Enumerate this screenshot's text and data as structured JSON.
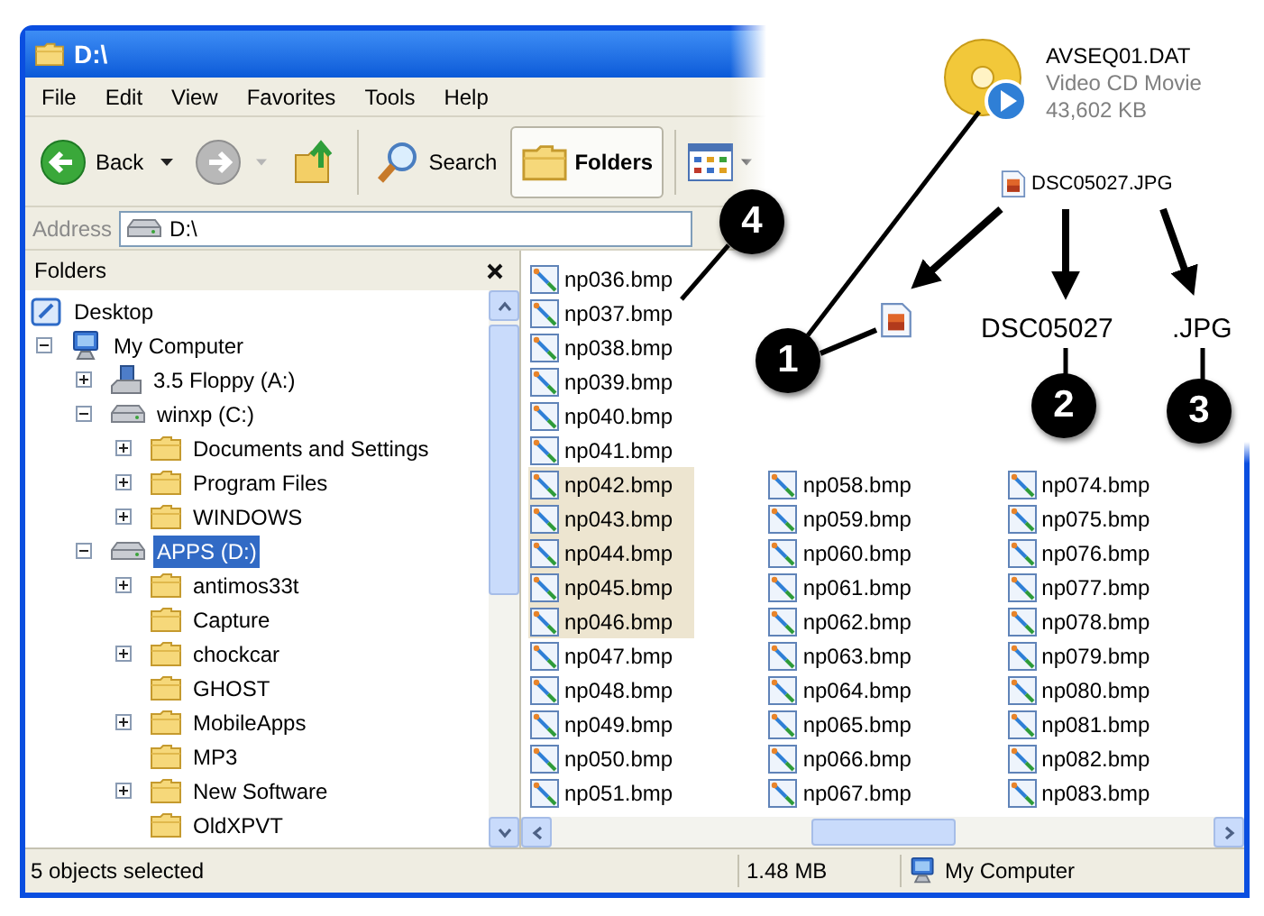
{
  "window": {
    "title": "D:\\"
  },
  "menu": [
    "File",
    "Edit",
    "View",
    "Favorites",
    "Tools",
    "Help"
  ],
  "toolbar": {
    "back": {
      "label": "Back"
    },
    "forward": {
      "disabled": true
    },
    "search": {
      "label": "Search"
    },
    "folders": {
      "label": "Folders",
      "selected": true
    }
  },
  "address": {
    "label": "Address",
    "value": "D:\\"
  },
  "folders_pane": {
    "title": "Folders",
    "tree": [
      {
        "label": "Desktop",
        "kind": "desktop",
        "expandable": false,
        "selected": false,
        "children": [
          {
            "label": "My Computer",
            "kind": "computer",
            "expandable": true,
            "expanded": true,
            "selected": false,
            "children": [
              {
                "label": "3.5 Floppy (A:)",
                "kind": "floppy",
                "expandable": true,
                "expanded": false,
                "selected": false
              },
              {
                "label": "winxp (C:)",
                "kind": "drive",
                "expandable": true,
                "expanded": true,
                "selected": false,
                "children": [
                  {
                    "label": "Documents and Settings",
                    "kind": "folder",
                    "expandable": true,
                    "expanded": false,
                    "selected": false
                  },
                  {
                    "label": "Program Files",
                    "kind": "folder",
                    "expandable": true,
                    "expanded": false,
                    "selected": false
                  },
                  {
                    "label": "WINDOWS",
                    "kind": "folder",
                    "expandable": true,
                    "expanded": false,
                    "selected": false
                  }
                ]
              },
              {
                "label": "APPS (D:)",
                "kind": "drive",
                "expandable": true,
                "expanded": true,
                "selected": true,
                "children": [
                  {
                    "label": "antimos33t",
                    "kind": "folder",
                    "expandable": true,
                    "expanded": false,
                    "selected": false
                  },
                  {
                    "label": "Capture",
                    "kind": "folder",
                    "expandable": false,
                    "selected": false
                  },
                  {
                    "label": "chockcar",
                    "kind": "folder",
                    "expandable": true,
                    "expanded": false,
                    "selected": false
                  },
                  {
                    "label": "GHOST",
                    "kind": "folder",
                    "expandable": false,
                    "selected": false
                  },
                  {
                    "label": "MobileApps",
                    "kind": "folder",
                    "expandable": true,
                    "expanded": false,
                    "selected": false
                  },
                  {
                    "label": "MP3",
                    "kind": "folder",
                    "expandable": false,
                    "selected": false
                  },
                  {
                    "label": "New Software",
                    "kind": "folder",
                    "expandable": true,
                    "expanded": false,
                    "selected": false
                  },
                  {
                    "label": "OldXPVT",
                    "kind": "folder",
                    "expandable": false,
                    "selected": false
                  }
                ]
              }
            ]
          }
        ]
      }
    ]
  },
  "file_list": {
    "columns": [
      {
        "items": [
          {
            "name": "np036.bmp",
            "selected": false
          },
          {
            "name": "np037.bmp",
            "selected": false
          },
          {
            "name": "np038.bmp",
            "selected": false
          },
          {
            "name": "np039.bmp",
            "selected": false
          },
          {
            "name": "np040.bmp",
            "selected": false
          },
          {
            "name": "np041.bmp",
            "selected": false
          },
          {
            "name": "np042.bmp",
            "selected": true
          },
          {
            "name": "np043.bmp",
            "selected": true
          },
          {
            "name": "np044.bmp",
            "selected": true
          },
          {
            "name": "np045.bmp",
            "selected": true
          },
          {
            "name": "np046.bmp",
            "selected": true
          },
          {
            "name": "np047.bmp",
            "selected": false
          },
          {
            "name": "np048.bmp",
            "selected": false
          },
          {
            "name": "np049.bmp",
            "selected": false
          },
          {
            "name": "np050.bmp",
            "selected": false
          },
          {
            "name": "np051.bmp",
            "selected": false
          }
        ]
      },
      {
        "items": [
          {
            "name": "np058.bmp",
            "selected": false
          },
          {
            "name": "np059.bmp",
            "selected": false
          },
          {
            "name": "np060.bmp",
            "selected": false
          },
          {
            "name": "np061.bmp",
            "selected": false
          },
          {
            "name": "np062.bmp",
            "selected": false
          },
          {
            "name": "np063.bmp",
            "selected": false
          },
          {
            "name": "np064.bmp",
            "selected": false
          },
          {
            "name": "np065.bmp",
            "selected": false
          },
          {
            "name": "np066.bmp",
            "selected": false
          },
          {
            "name": "np067.bmp",
            "selected": false
          }
        ]
      },
      {
        "items": [
          {
            "name": "np074.bmp",
            "selected": false
          },
          {
            "name": "np075.bmp",
            "selected": false
          },
          {
            "name": "np076.bmp",
            "selected": false
          },
          {
            "name": "np077.bmp",
            "selected": false
          },
          {
            "name": "np078.bmp",
            "selected": false
          },
          {
            "name": "np079.bmp",
            "selected": false
          },
          {
            "name": "np080.bmp",
            "selected": false
          },
          {
            "name": "np081.bmp",
            "selected": false
          },
          {
            "name": "np082.bmp",
            "selected": false
          },
          {
            "name": "np083.bmp",
            "selected": false
          }
        ]
      }
    ]
  },
  "status_bar": [
    "5 objects selected",
    "1.48 MB",
    "My Computer"
  ],
  "annotation": {
    "video_file": {
      "name": "AVSEQ01.DAT",
      "type": "Video CD Movie",
      "size": "43,602 KB"
    },
    "image_file": "DSC05027.JPG",
    "name_part": "DSC05027",
    "extension_part": ".JPG",
    "callouts": [
      "4",
      "1",
      "2",
      "3"
    ]
  }
}
